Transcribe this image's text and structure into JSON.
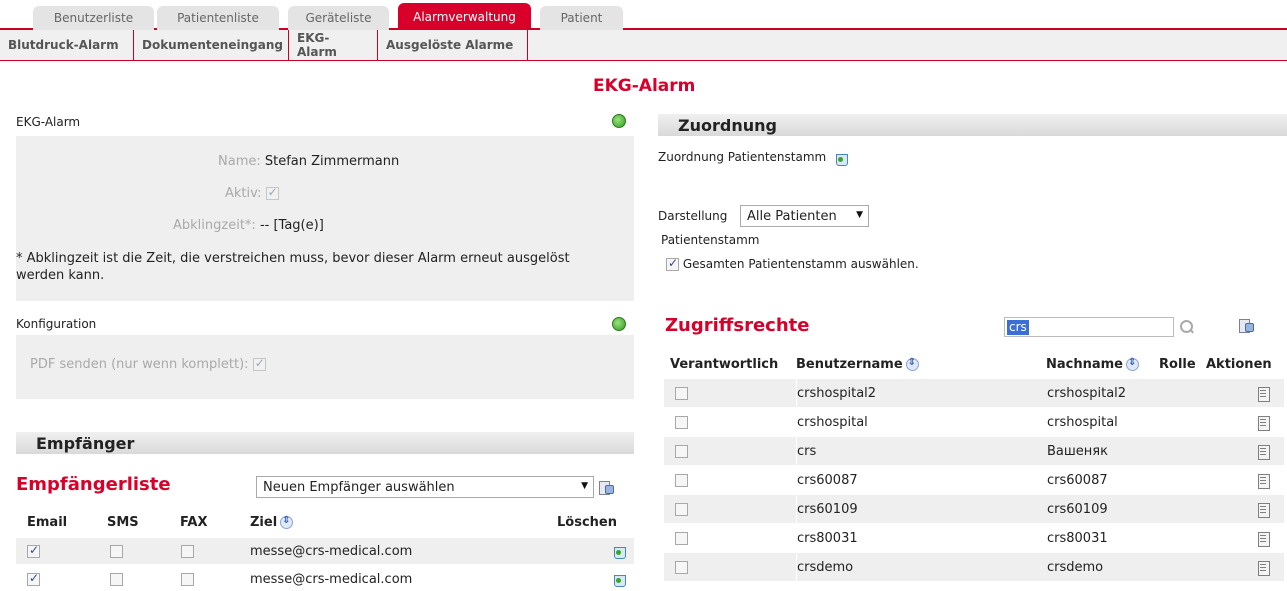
{
  "tabs": [
    "Benutzerliste",
    "Patientenliste",
    "Geräteliste",
    "Alarmverwaltung",
    "Patient"
  ],
  "active_tab": "Alarmverwaltung",
  "subtabs": [
    "Blutdruck-Alarm",
    "Dokumenteneingang",
    "EKG-Alarm",
    "Ausgelöste Alarme"
  ],
  "page_title": "EKG-Alarm",
  "alarm": {
    "section_label": "EKG-Alarm",
    "name_label": "Name:",
    "name_value": "Stefan Zimmermann",
    "aktiv_label": "Aktiv:",
    "aktiv_checked": true,
    "abkling_label": "Abklingzeit*:",
    "abkling_value": "-- [Tag(e)]",
    "footnote": "* Abklingzeit ist die Zeit, die verstreichen muss, bevor dieser Alarm erneut ausgelöst werden kann."
  },
  "konfiguration": {
    "section_label": "Konfiguration",
    "pdf_label": "PDF senden (nur wenn komplett):",
    "pdf_checked": true
  },
  "empfaenger": {
    "section_title": "Empfänger",
    "list_title": "Empfängerliste",
    "select_value": "Neuen Empfänger auswählen",
    "columns": [
      "Email",
      "SMS",
      "FAX",
      "Ziel",
      "Löschen"
    ],
    "rows": [
      {
        "email": true,
        "sms": false,
        "fax": false,
        "ziel": "messe@crs-medical.com"
      },
      {
        "email": true,
        "sms": false,
        "fax": false,
        "ziel": "messe@crs-medical.com"
      }
    ]
  },
  "zuordnung": {
    "section_title": "Zuordnung",
    "stamm_label": "Zuordnung Patientenstamm",
    "darstellung_label": "Darstellung",
    "darstellung_value": "Alle Patienten",
    "patientenstamm_label": "Patientenstamm",
    "gesamt_label": "Gesamten Patientenstamm auswählen.",
    "gesamt_checked": true
  },
  "zugriffsrechte": {
    "title": "Zugriffsrechte",
    "search_value": "crs",
    "columns": [
      "Verantwortlich",
      "Benutzername",
      "Nachname",
      "Rolle",
      "Aktionen"
    ],
    "rows": [
      {
        "benutzername": "crshospital2",
        "nachname": "crshospital2",
        "rolle": ""
      },
      {
        "benutzername": "crshospital",
        "nachname": "crshospital",
        "rolle": ""
      },
      {
        "benutzername": "crs",
        "nachname": "Вашеняк",
        "rolle": ""
      },
      {
        "benutzername": "crs60087",
        "nachname": "crs60087",
        "rolle": ""
      },
      {
        "benutzername": "crs60109",
        "nachname": "crs60109",
        "rolle": ""
      },
      {
        "benutzername": "crs80031",
        "nachname": "crs80031",
        "rolle": ""
      },
      {
        "benutzername": "crsdemo",
        "nachname": "crsdemo",
        "rolle": ""
      }
    ]
  }
}
